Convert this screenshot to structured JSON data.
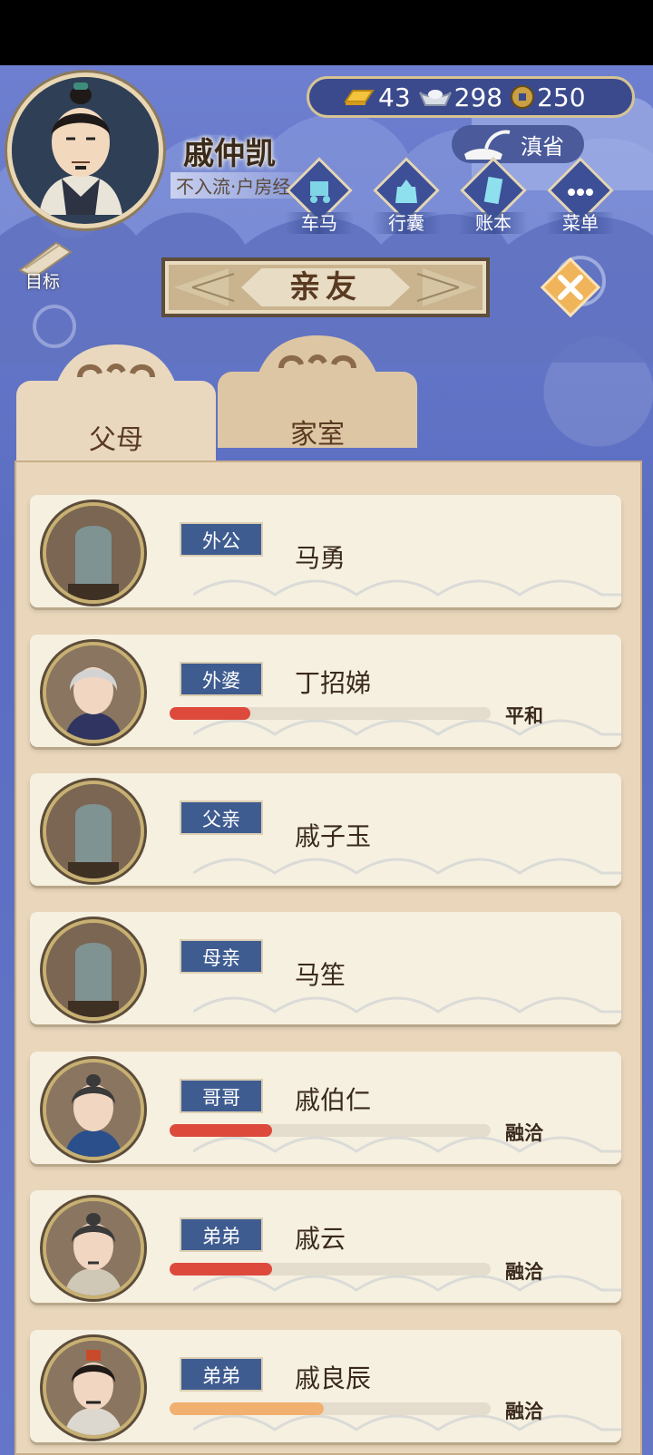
{
  "player": {
    "name": "戚仲凯",
    "title": "不入流·户房经"
  },
  "currency": {
    "gold": "43",
    "silver": "298",
    "coins": "250"
  },
  "province": "滇省",
  "menu": [
    {
      "id": "carriage",
      "label": "车马",
      "icon": "carriage-icon"
    },
    {
      "id": "bag",
      "label": "行囊",
      "icon": "bag-icon"
    },
    {
      "id": "ledger",
      "label": "账本",
      "icon": "ledger-icon"
    },
    {
      "id": "menu",
      "label": "菜单",
      "icon": "more-icon"
    }
  ],
  "goal_label": "目标",
  "header_title": "亲友",
  "tabs": [
    {
      "label": "父母",
      "active": true
    },
    {
      "label": "家室",
      "active": false
    }
  ],
  "colors": {
    "bar_red": "#dd4a3c",
    "bar_orange": "#f1b06f",
    "badge_blue": "#3f5c91"
  },
  "members": [
    {
      "relation": "外公",
      "name": "马勇",
      "deceased": true
    },
    {
      "relation": "外婆",
      "name": "丁招娣",
      "mood": "平和",
      "affinity": 0.25,
      "bar_color": "#dd4a3c"
    },
    {
      "relation": "父亲",
      "name": "戚子玉",
      "deceased": true
    },
    {
      "relation": "母亲",
      "name": "马笙",
      "deceased": true
    },
    {
      "relation": "哥哥",
      "name": "戚伯仁",
      "mood": "融洽",
      "affinity": 0.32,
      "bar_color": "#dd4a3c"
    },
    {
      "relation": "弟弟",
      "name": "戚云",
      "mood": "融洽",
      "affinity": 0.32,
      "bar_color": "#dd4a3c"
    },
    {
      "relation": "弟弟",
      "name": "戚良辰",
      "mood": "融洽",
      "affinity": 0.48,
      "bar_color": "#f1b06f"
    }
  ]
}
